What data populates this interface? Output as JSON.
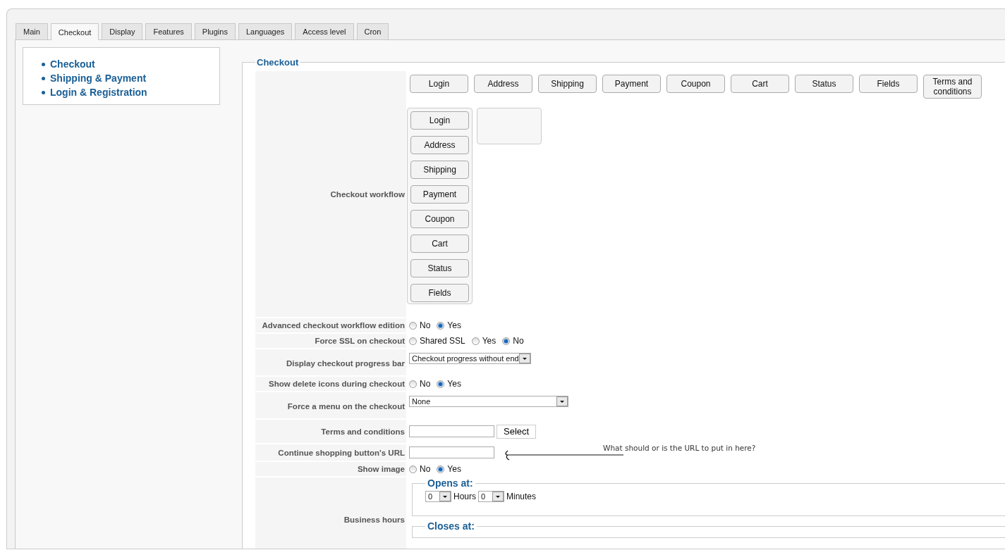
{
  "tabs": [
    {
      "label": "Main",
      "selected": false
    },
    {
      "label": "Checkout",
      "selected": true
    },
    {
      "label": "Display",
      "selected": false
    },
    {
      "label": "Features",
      "selected": false
    },
    {
      "label": "Plugins",
      "selected": false
    },
    {
      "label": "Languages",
      "selected": false
    },
    {
      "label": "Access level",
      "selected": false
    },
    {
      "label": "Cron",
      "selected": false
    }
  ],
  "sidebar": {
    "items": [
      "Checkout",
      "Shipping & Payment",
      "Login & Registration"
    ]
  },
  "fieldset": {
    "legend": "Checkout",
    "rows": [
      {
        "kind": "workflow",
        "label": "Checkout workflow",
        "palette": [
          "Login",
          "Address",
          "Shipping",
          "Payment",
          "Coupon",
          "Cart",
          "Status",
          "Fields",
          "Terms and conditions"
        ],
        "steps": [
          "Login",
          "Address",
          "Shipping",
          "Payment",
          "Coupon",
          "Cart",
          "Status",
          "Fields"
        ]
      },
      {
        "kind": "radio",
        "label": "Advanced checkout workflow edition",
        "options": [
          {
            "label": "No",
            "selected": false
          },
          {
            "label": "Yes",
            "selected": true
          }
        ]
      },
      {
        "kind": "radio",
        "label": "Force SSL on checkout",
        "options": [
          {
            "label": "Shared SSL",
            "selected": false
          },
          {
            "label": "Yes",
            "selected": false
          },
          {
            "label": "No",
            "selected": true
          }
        ]
      },
      {
        "kind": "select",
        "label": "Display checkout progress bar",
        "value": "Checkout progress without end"
      },
      {
        "kind": "radio",
        "label": "Show delete icons during checkout",
        "options": [
          {
            "label": "No",
            "selected": false
          },
          {
            "label": "Yes",
            "selected": true
          }
        ]
      },
      {
        "kind": "wide_select",
        "label": "Force a menu on the checkout",
        "value": "None"
      },
      {
        "kind": "picker",
        "label": "Terms and conditions",
        "button": "Select"
      },
      {
        "kind": "input",
        "label": "Continue shopping button's URL",
        "annotation": "What should or is the URL to put in here?"
      },
      {
        "kind": "radio",
        "label": "Show image",
        "options": [
          {
            "label": "No",
            "selected": false
          },
          {
            "label": "Yes",
            "selected": true
          }
        ]
      },
      {
        "kind": "hours",
        "label": "Business hours",
        "groups": [
          {
            "legend": "Opens at:",
            "hours": "0",
            "hours_label": "Hours",
            "minutes": "0",
            "minutes_label": "Minutes"
          },
          {
            "legend": "Closes at:"
          }
        ]
      }
    ]
  }
}
